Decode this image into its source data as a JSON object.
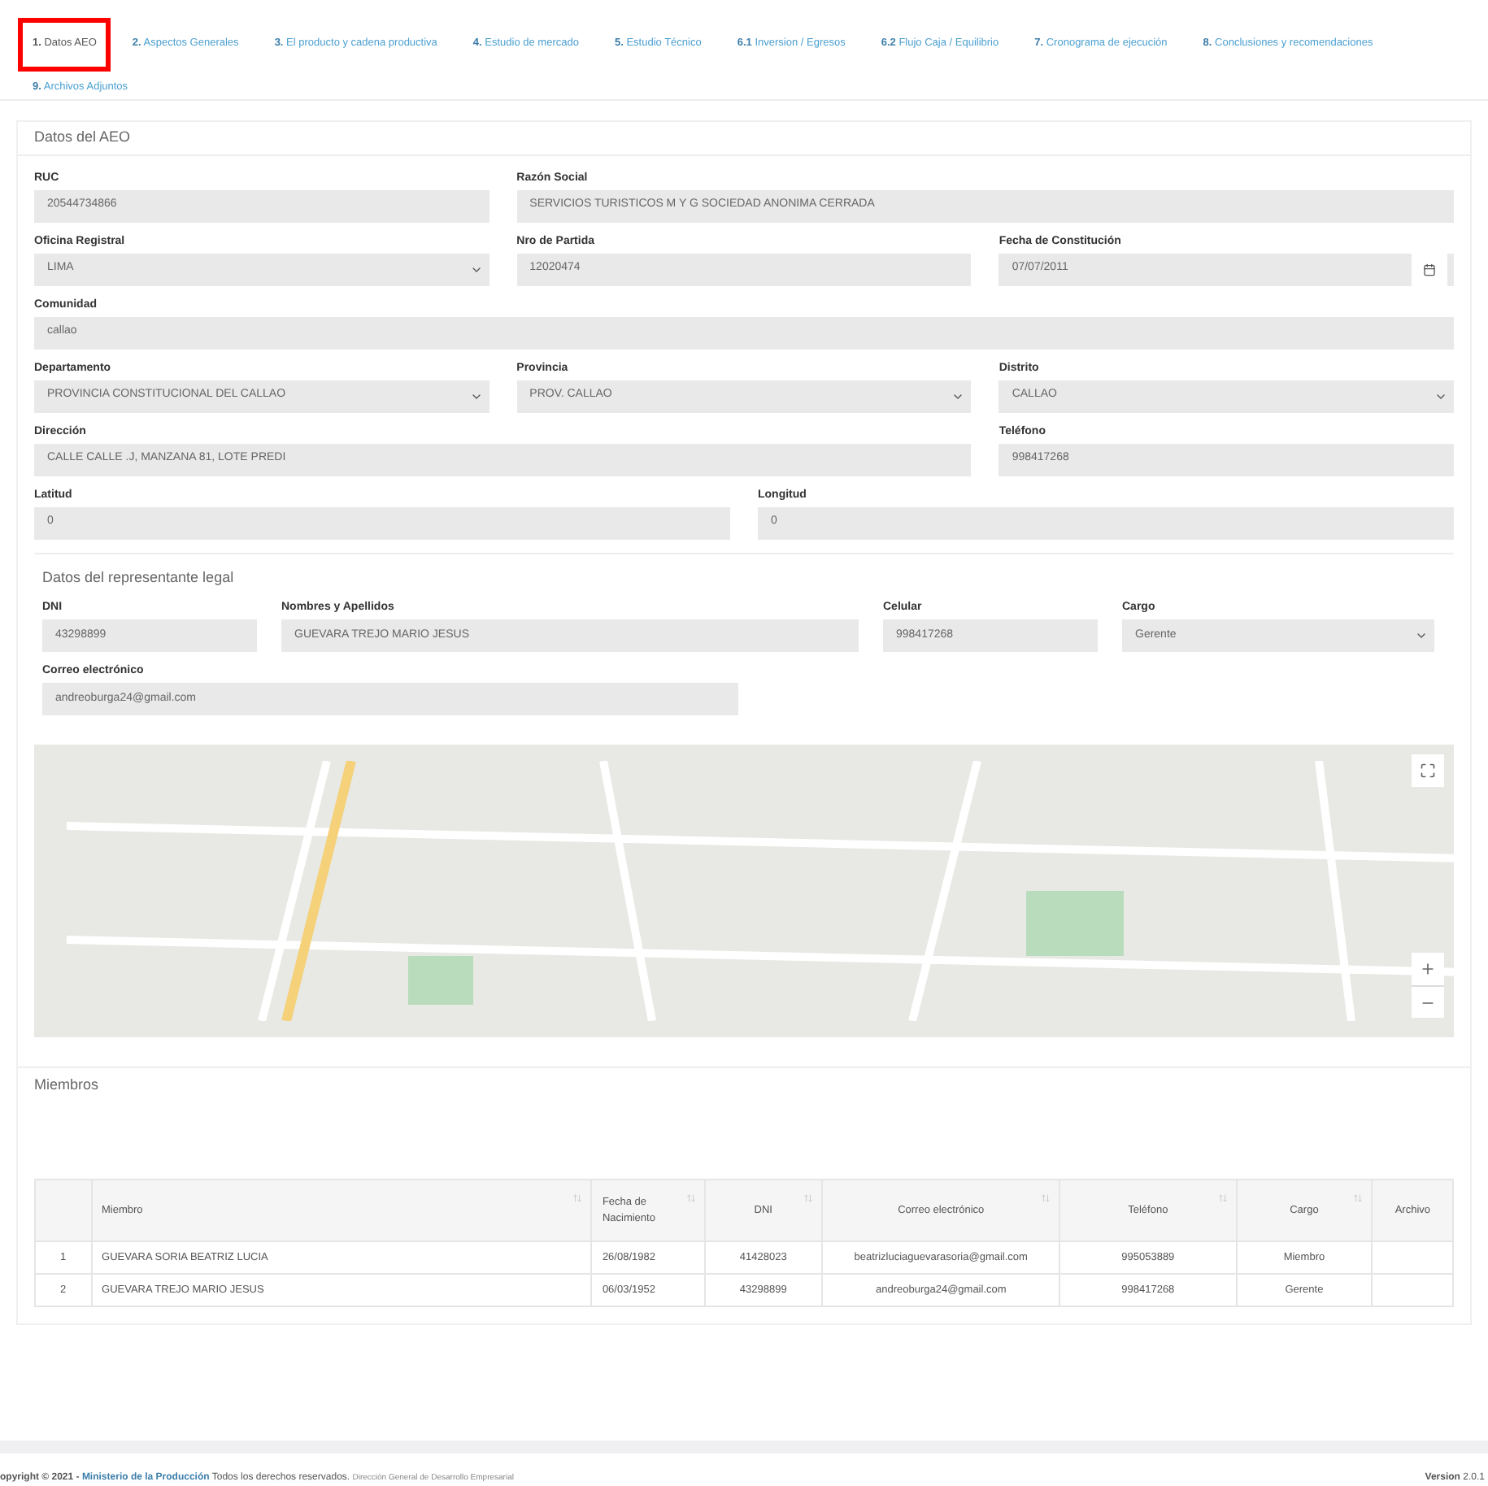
{
  "tabs": [
    {
      "number": "1.",
      "label": "Datos AEO",
      "selected": true
    },
    {
      "number": "2.",
      "label": "Aspectos Generales",
      "selected": false
    },
    {
      "number": "3.",
      "label": "El producto y cadena productiva",
      "selected": false
    },
    {
      "number": "4.",
      "label": "Estudio de mercado",
      "selected": false
    },
    {
      "number": "5.",
      "label": "Estudio Técnico",
      "selected": false
    },
    {
      "number": "6.1",
      "label": "Inversion / Egresos",
      "selected": false
    },
    {
      "number": "6.2",
      "label": "Flujo Caja / Equilibrio",
      "selected": false
    },
    {
      "number": "7.",
      "label": "Cronograma de ejecución",
      "selected": false
    },
    {
      "number": "8.",
      "label": "Conclusiones y recomendaciones",
      "selected": false
    },
    {
      "number": "9.",
      "label": "Archivos Adjuntos",
      "selected": false
    }
  ],
  "aeo": {
    "title": "Datos del AEO",
    "fields": [
      {
        "label": "RUC",
        "value": "20544734866",
        "kind": "text"
      },
      {
        "label": "Razón Social",
        "value": "SERVICIOS TURISTICOS M Y G SOCIEDAD ANONIMA CERRADA",
        "kind": "text"
      },
      {
        "label": "Oficina Registral",
        "value": "LIMA",
        "kind": "select"
      },
      {
        "label": "Nro de Partida",
        "value": "12020474",
        "kind": "text"
      },
      {
        "label": "Fecha de Constitución",
        "value": "07/07/2011",
        "kind": "date"
      },
      {
        "label": "Comunidad",
        "value": "callao",
        "kind": "text"
      },
      {
        "label": "Departamento",
        "value": "PROVINCIA CONSTITUCIONAL DEL CALLAO",
        "kind": "select"
      },
      {
        "label": "Provincia",
        "value": "PROV. CALLAO",
        "kind": "select"
      },
      {
        "label": "Distrito",
        "value": "CALLAO",
        "kind": "select"
      },
      {
        "label": "Dirección",
        "value": "CALLE CALLE .J, MANZANA 81, LOTE PREDI",
        "kind": "text"
      },
      {
        "label": "Teléfono",
        "value": "998417268",
        "kind": "text"
      }
    ],
    "coords": [
      {
        "label": "Latitud",
        "value": "0"
      },
      {
        "label": "Longitud",
        "value": "0"
      }
    ]
  },
  "representative": {
    "title": "Datos del representante legal",
    "fields": [
      {
        "label": "DNI",
        "value": "43298899",
        "kind": "text"
      },
      {
        "label": "Nombres y Apellidos",
        "value": "GUEVARA TREJO MARIO JESUS",
        "kind": "text"
      },
      {
        "label": "Celular",
        "value": "998417268",
        "kind": "text"
      },
      {
        "label": "Cargo",
        "value": "Gerente",
        "kind": "select"
      }
    ],
    "email": {
      "label": "Correo electrónico",
      "value": "andreoburga24@gmail.com"
    }
  },
  "members": {
    "title": "Miembros",
    "columns": [
      {
        "sortable": false
      },
      {
        "label": "Miembro",
        "sortable": true
      },
      {
        "label": "Fecha de Nacimiento",
        "sortable": true
      },
      {
        "label": "DNI",
        "sortable": true
      },
      {
        "label": "Correo electrónico",
        "sortable": true
      },
      {
        "label": "Teléfono",
        "sortable": true
      },
      {
        "label": "Cargo",
        "sortable": true
      },
      {
        "label": "Archivo",
        "sortable": false
      }
    ],
    "rows": [
      [
        "1",
        "GUEVARA SORIA BEATRIZ LUCIA",
        "26/08/1982",
        "41428023",
        "beatrizluciaguevarasoria@gmail.com",
        "995053889",
        "Miembro",
        ""
      ],
      [
        "2",
        "GUEVARA TREJO MARIO JESUS",
        "06/03/1952",
        "43298899",
        "andreoburga24@gmail.com",
        "998417268",
        "Gerente",
        ""
      ]
    ]
  },
  "footer": {
    "copyright": "opyright © 2021 -",
    "link": "Ministerio de la Producción",
    "rights": "Todos los derechos reservados.",
    "office": "Dirección General de Desarrollo Empresarial",
    "version_label": "Version",
    "version": "2.0.1"
  }
}
